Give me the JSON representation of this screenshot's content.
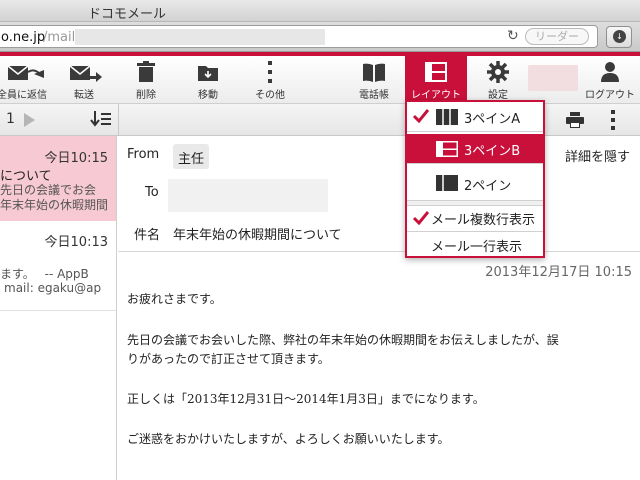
{
  "browser": {
    "title": "ドコモメール",
    "url_host": "o.ne.jp",
    "url_path": "/mail/",
    "reader_label": "リーダー"
  },
  "toolbar": {
    "reply_all": "全員に返信",
    "forward": "転送",
    "delete": "削除",
    "move": "移動",
    "other": "その他",
    "phonebook": "電話帳",
    "layout": "レイアウト",
    "settings": "設定",
    "logout": "ログアウト"
  },
  "pager": {
    "page": "1"
  },
  "list": {
    "items": [
      {
        "time": "今日10:15",
        "line1": "について",
        "line2": "先日の会議でお会",
        "line3": "年末年始の休暇期間"
      },
      {
        "time": "今日10:13",
        "line1": "ます。　 --  AppB",
        "line2": "mail: egaku@ap"
      }
    ]
  },
  "header": {
    "from_label": "From",
    "from_value": "主任",
    "to_label": "To",
    "subject_label": "件名",
    "subject_value": "年末年始の休暇期間について",
    "detail_toggle": "詳細を隠す"
  },
  "mail": {
    "date": "2013年12月17日 10:15",
    "lines": [
      "お疲れさまです。",
      "先日の会議でお会いした際、弊社の年末年始の休暇期間をお伝えしましたが、誤",
      "りがあったので訂正させて頂きます。",
      "正しくは「2013年12月31日〜2014年1月3日」までになります。",
      "ご迷惑をおかけいたしますが、よろしくお願いいたします。"
    ]
  },
  "layout_menu": {
    "items": [
      {
        "label": "3ペインA",
        "checked": true
      },
      {
        "label": "3ペインB",
        "checked": false
      },
      {
        "label": "2ペイン",
        "checked": false
      }
    ],
    "options": [
      {
        "label": "メール複数行表示",
        "checked": true
      },
      {
        "label": "メール一行表示",
        "checked": false
      }
    ]
  },
  "colors": {
    "accent": "#c8103a",
    "selected_row": "#f7cad3"
  }
}
